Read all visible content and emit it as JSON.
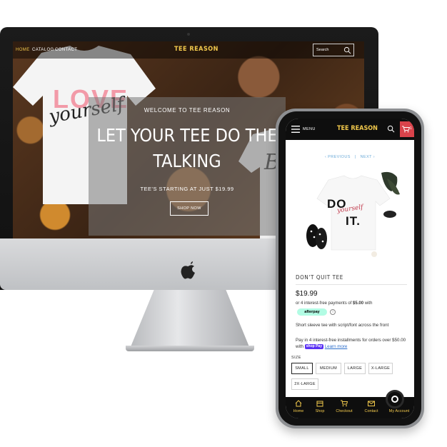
{
  "desktop": {
    "nav": {
      "home": "HOME",
      "catalog": "CATALOG",
      "contact": "CONTACT"
    },
    "logo": "TEE REASON",
    "search_placeholder": "Search",
    "hero": {
      "welcome": "WELCOME TO TEE REASON",
      "title_line1": "LET YOUR TEE DO THE",
      "title_line2": "TALKING",
      "subtitle": "TEE'S STARTING AT JUST $19.99",
      "button": "SHOP NOW"
    },
    "shirt_left_print": {
      "script": "yourself",
      "block": "LOVE"
    },
    "shirt_right_print": "Be"
  },
  "mobile": {
    "menu_label": "MENU",
    "logo": "TEE REASON",
    "cart_count": "1",
    "pager": {
      "previous": "‹ PREVIOUS",
      "separator": "|",
      "next": "NEXT ›"
    },
    "product_print": {
      "line1": "DO",
      "script": "yourself",
      "line2": "IT."
    },
    "product_name": "DON'T QUIT TEE",
    "price": "$19.99",
    "afterpay_prefix": "or 4 interest-free payments of",
    "afterpay_amount": "$5.00",
    "afterpay_suffix": "with",
    "afterpay_badge": "afterpay",
    "info": "i",
    "description": "Short sleeve tee with script/font across the front",
    "shoppay_text": "Pay in 4 interest-free installments for orders over $50.00 with",
    "shoppay_badge": "shop Pay",
    "learn_more": "Learn more",
    "size_label": "SIZE",
    "sizes": [
      "SMALL",
      "MEDIUM",
      "LARGE",
      "X-LARGE",
      "2X-LARGE"
    ],
    "selected_size": "SMALL",
    "bottom_nav": [
      "Home",
      "Shop",
      "Checkout",
      "Contact",
      "My Account"
    ]
  },
  "colors": {
    "brand_yellow": "#f2c94c",
    "cart_red": "#d9434b",
    "afterpay_mint": "#b2fce4",
    "shoppay_purple": "#5a31f4",
    "link_blue": "#6aa9d8"
  }
}
